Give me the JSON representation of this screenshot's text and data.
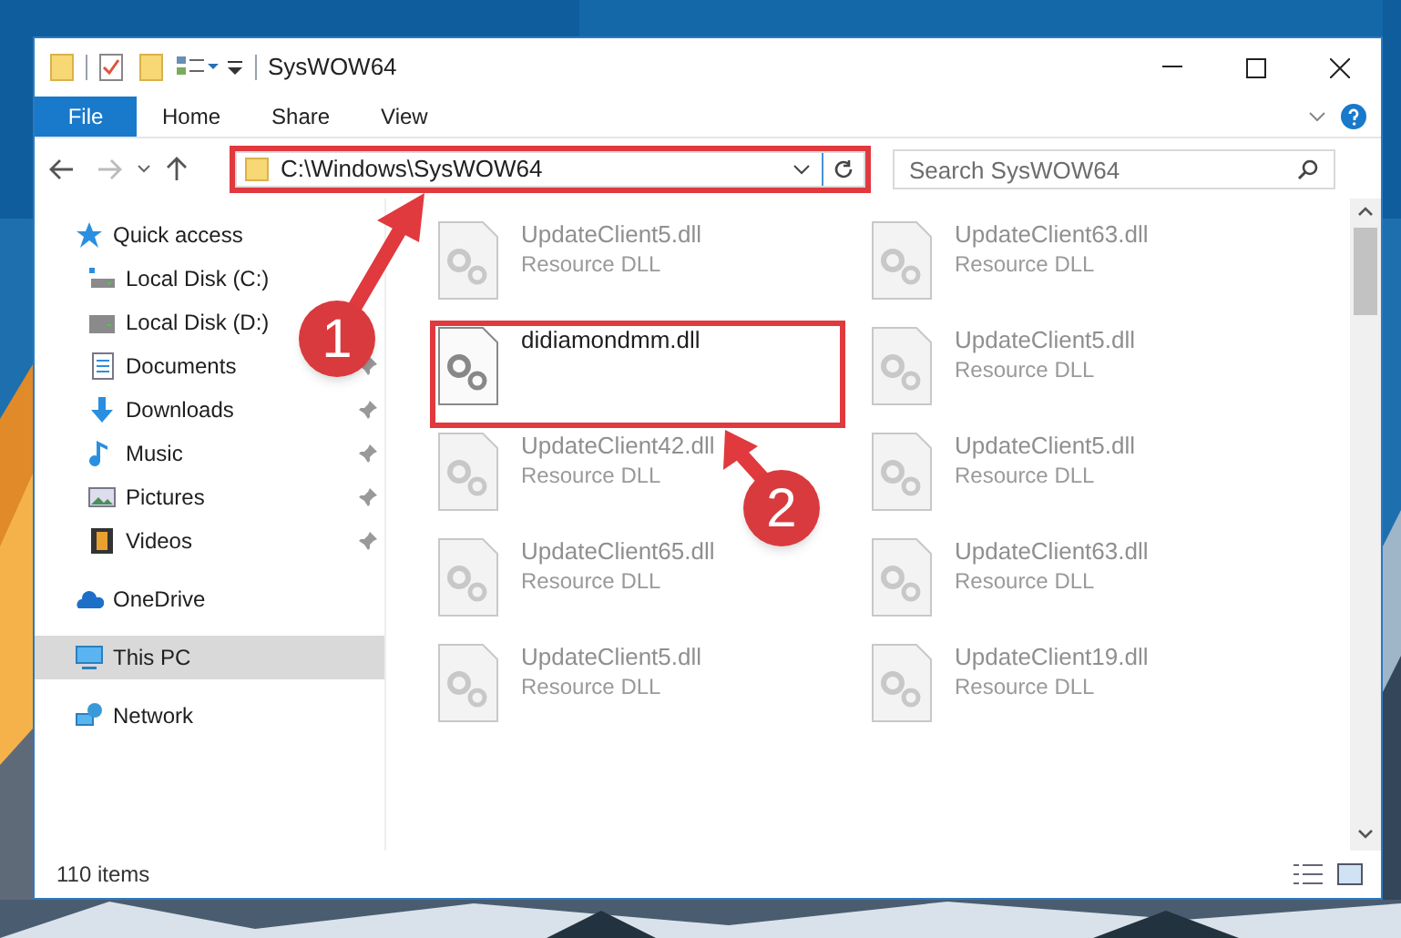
{
  "window": {
    "title": "SysWOW64"
  },
  "ribbon": {
    "tabs": [
      {
        "label": "File",
        "kind": "file"
      },
      {
        "label": "Home",
        "kind": "tab"
      },
      {
        "label": "Share",
        "kind": "tab"
      },
      {
        "label": "View",
        "kind": "tab"
      }
    ]
  },
  "address_bar": {
    "path": "C:\\Windows\\SysWOW64"
  },
  "search": {
    "placeholder": "Search SysWOW64"
  },
  "sidebar": {
    "items": [
      {
        "label": "Quick access",
        "kind": "star",
        "selected": false,
        "children": [
          {
            "label": "Local Disk (C:)",
            "kind": "drive-c",
            "pinned": false
          },
          {
            "label": "Local Disk (D:)",
            "kind": "drive",
            "pinned": false
          },
          {
            "label": "Documents",
            "kind": "documents",
            "pinned": true
          },
          {
            "label": "Downloads",
            "kind": "downloads",
            "pinned": true
          },
          {
            "label": "Music",
            "kind": "music",
            "pinned": true
          },
          {
            "label": "Pictures",
            "kind": "pictures",
            "pinned": true
          },
          {
            "label": "Videos",
            "kind": "videos",
            "pinned": true
          }
        ]
      },
      {
        "label": "OneDrive",
        "kind": "cloud",
        "selected": false
      },
      {
        "label": "This PC",
        "kind": "pc",
        "selected": true
      },
      {
        "label": "Network",
        "kind": "network",
        "selected": false
      }
    ]
  },
  "files": [
    {
      "name": "UpdateClient5.dll",
      "type": "Resource DLL",
      "blurred": true
    },
    {
      "name": "UpdateClient63.dll",
      "type": "Resource DLL",
      "blurred": true
    },
    {
      "name": "didiamondmm.dll",
      "blurred": false
    },
    {
      "name": "UpdateClient5.dll",
      "type": "Resource DLL",
      "blurred": true
    },
    {
      "name": "UpdateClient42.dll",
      "type": "Resource DLL",
      "blurred": true
    },
    {
      "name": "UpdateClient5.dll",
      "type": "Resource DLL",
      "blurred": true
    },
    {
      "name": "UpdateClient65.dll",
      "type": "Resource DLL",
      "blurred": true
    },
    {
      "name": "UpdateClient63.dll",
      "type": "Resource DLL",
      "blurred": true
    },
    {
      "name": "UpdateClient5.dll",
      "type": "Resource DLL",
      "blurred": true
    },
    {
      "name": "UpdateClient19.dll",
      "type": "Resource DLL",
      "blurred": true
    }
  ],
  "callouts": [
    {
      "number": "1"
    },
    {
      "number": "2"
    }
  ],
  "status_bar": {
    "item_count": "110 items"
  }
}
